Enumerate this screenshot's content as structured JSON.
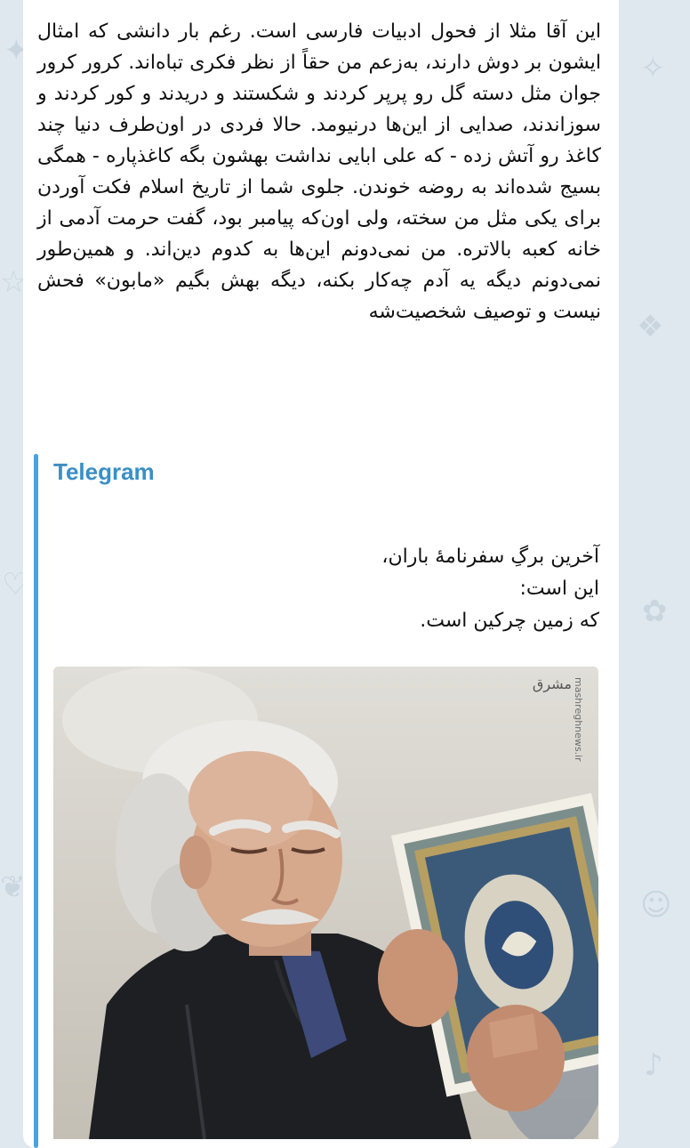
{
  "wallpaper": {
    "background_color": "#dfe8ee",
    "doodle_color": "#c9d6df"
  },
  "message": {
    "text": "این آقا مثلا از فحول ادبیات فارسی است. رغم بار دانشی که امثال ایشون بر دوش دارند، به‌زعم من حقاً از نظر فکری تباه‌اند. کرور کرور جوان مثل دسته گل رو پرپر کردند و شکستند و دریدند و کور کردند و سوزاندند، صدایی از این‌ها درنیومد. حالا فردی در اون‌طرف دنیا چند کاغذ رو آتش زده - که علی ابایی نداشت بهشون بگه کاغذپاره - همگی بسیج شده‌اند به روضه خوندن. جلوی شما از تاریخ اسلام فکت آوردن برای یکی مثل من سخته، ولی اون‌که پیامبر بود، گفت حرمت آدمی از خانه کعبه بالاتره. من نمی‌دونم این‌ها به کدوم دین‌اند. و همین‌طور نمی‌دونم دیگه یه آدم چه‌کار بکنه، دیگه بهش بگیم «مابون» فحش نیست و توصیف شخصیت‌شه"
  },
  "link_preview": {
    "site_name": "Telegram",
    "accent_color": "#4aa3df",
    "description_lines": [
      "آخرین برگِ سفرنامهٔ باران،",
      "این است:",
      "که زمین چرکین است."
    ],
    "photo": {
      "watermark_site": "mashreghnews.ir",
      "watermark_logo": "مشرق"
    }
  }
}
